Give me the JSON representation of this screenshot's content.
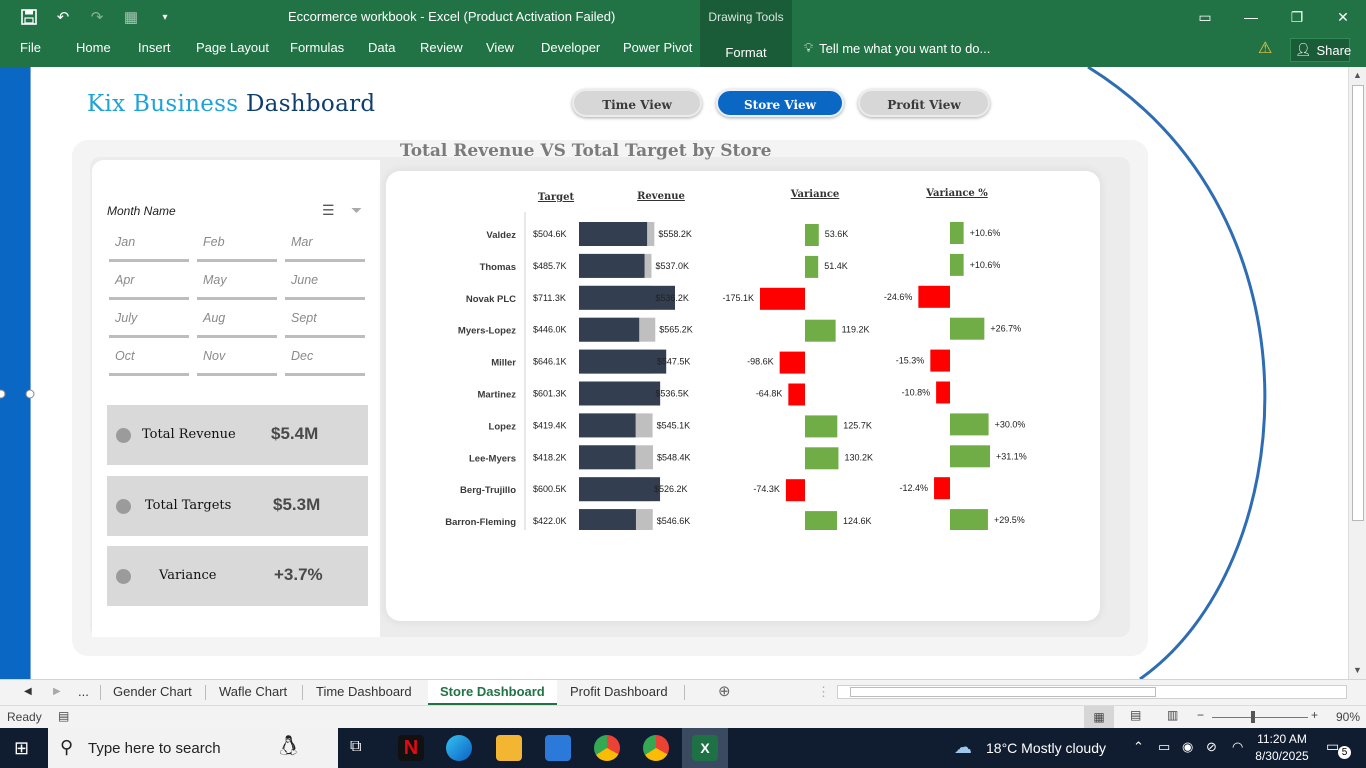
{
  "window": {
    "title": "Eccormerce workbook - Excel (Product Activation Failed)",
    "context_tab_group": "Drawing Tools"
  },
  "ribbon": {
    "tabs": [
      "File",
      "Home",
      "Insert",
      "Page Layout",
      "Formulas",
      "Data",
      "Review",
      "View",
      "Developer",
      "Power Pivot",
      "Format"
    ],
    "active_tab": "Format",
    "tell_me": "Tell me what you want to do...",
    "share": "Share"
  },
  "dashboard": {
    "title_part1": "Kix Business ",
    "title_part2": "Dashboard",
    "nav": {
      "time_view": "Time View",
      "store_view": "Store View",
      "profit_view": "Profit View"
    },
    "slicer": {
      "title": "Month Name",
      "months": [
        "Jan",
        "Feb",
        "Mar",
        "Apr",
        "May",
        "June",
        "July",
        "Aug",
        "Sept",
        "Oct",
        "Nov",
        "Dec"
      ]
    },
    "kpis": {
      "revenue_label": "Total Revenue",
      "revenue_value": "$5.4M",
      "targets_label": "Total Targets",
      "targets_value": "$5.3M",
      "variance_label": "Variance",
      "variance_value": "+3.7%"
    }
  },
  "chart_data": {
    "type": "bar",
    "title": "Total Revenue VS Total Target by Store",
    "columns": {
      "target": "Target",
      "revenue": "Revenue",
      "variance": "Variance",
      "variance_pct": "Variance %"
    },
    "stores": [
      "Valdez",
      "Thomas",
      "Novak PLC",
      "Myers-Lopez",
      "Miller",
      "Martinez",
      "Lopez",
      "Lee-Myers",
      "Berg-Trujillo",
      "Barron-Fleming"
    ],
    "target": [
      504.6,
      485.7,
      711.3,
      446.0,
      646.1,
      601.3,
      419.4,
      418.2,
      600.5,
      422.0
    ],
    "revenue": [
      558.2,
      537.0,
      536.2,
      565.2,
      547.5,
      536.5,
      545.1,
      548.4,
      526.2,
      546.6
    ],
    "variance": [
      53.6,
      51.4,
      -175.1,
      119.2,
      -98.6,
      -64.8,
      125.7,
      130.2,
      -74.3,
      124.6
    ],
    "variance_pct": [
      10.6,
      10.6,
      -24.6,
      26.7,
      -15.3,
      -10.8,
      30.0,
      31.1,
      -12.4,
      29.5
    ],
    "target_labels": [
      "$504.6K",
      "$485.7K",
      "$711.3K",
      "$446.0K",
      "$646.1K",
      "$601.3K",
      "$419.4K",
      "$418.2K",
      "$600.5K",
      "$422.0K"
    ],
    "revenue_labels": [
      "$558.2K",
      "$537.0K",
      "$536.2K",
      "$565.2K",
      "$547.5K",
      "$536.5K",
      "$545.1K",
      "$548.4K",
      "$526.2K",
      "$546.6K"
    ],
    "variance_labels": [
      "53.6K",
      "51.4K",
      "-175.1K",
      "119.2K",
      "-98.6K",
      "-64.8K",
      "125.7K",
      "130.2K",
      "-74.3K",
      "124.6K"
    ],
    "variance_pct_labels": [
      "+10.6%",
      "+10.6%",
      "-24.6%",
      "+26.7%",
      "-15.3%",
      "-10.8%",
      "+30.0%",
      "+31.1%",
      "-12.4%",
      "+29.5%"
    ],
    "colors": {
      "target_bar": "#333f50",
      "revenue_bar": "#bfbfbf",
      "positive": "#70ad47",
      "negative": "#ff0000"
    }
  },
  "sheet_tabs": {
    "ellipsis": "...",
    "tabs": [
      "Gender Chart",
      "Wafle Chart",
      "Time Dashboard",
      "Store Dashboard",
      "Profit Dashboard"
    ],
    "active": "Store Dashboard"
  },
  "status": {
    "ready": "Ready",
    "zoom": "90%"
  },
  "taskbar": {
    "search_placeholder": "Type here to search",
    "weather": "18°C  Mostly cloudy",
    "time": "11:20 AM",
    "date": "8/30/2025",
    "notifications": "5"
  }
}
